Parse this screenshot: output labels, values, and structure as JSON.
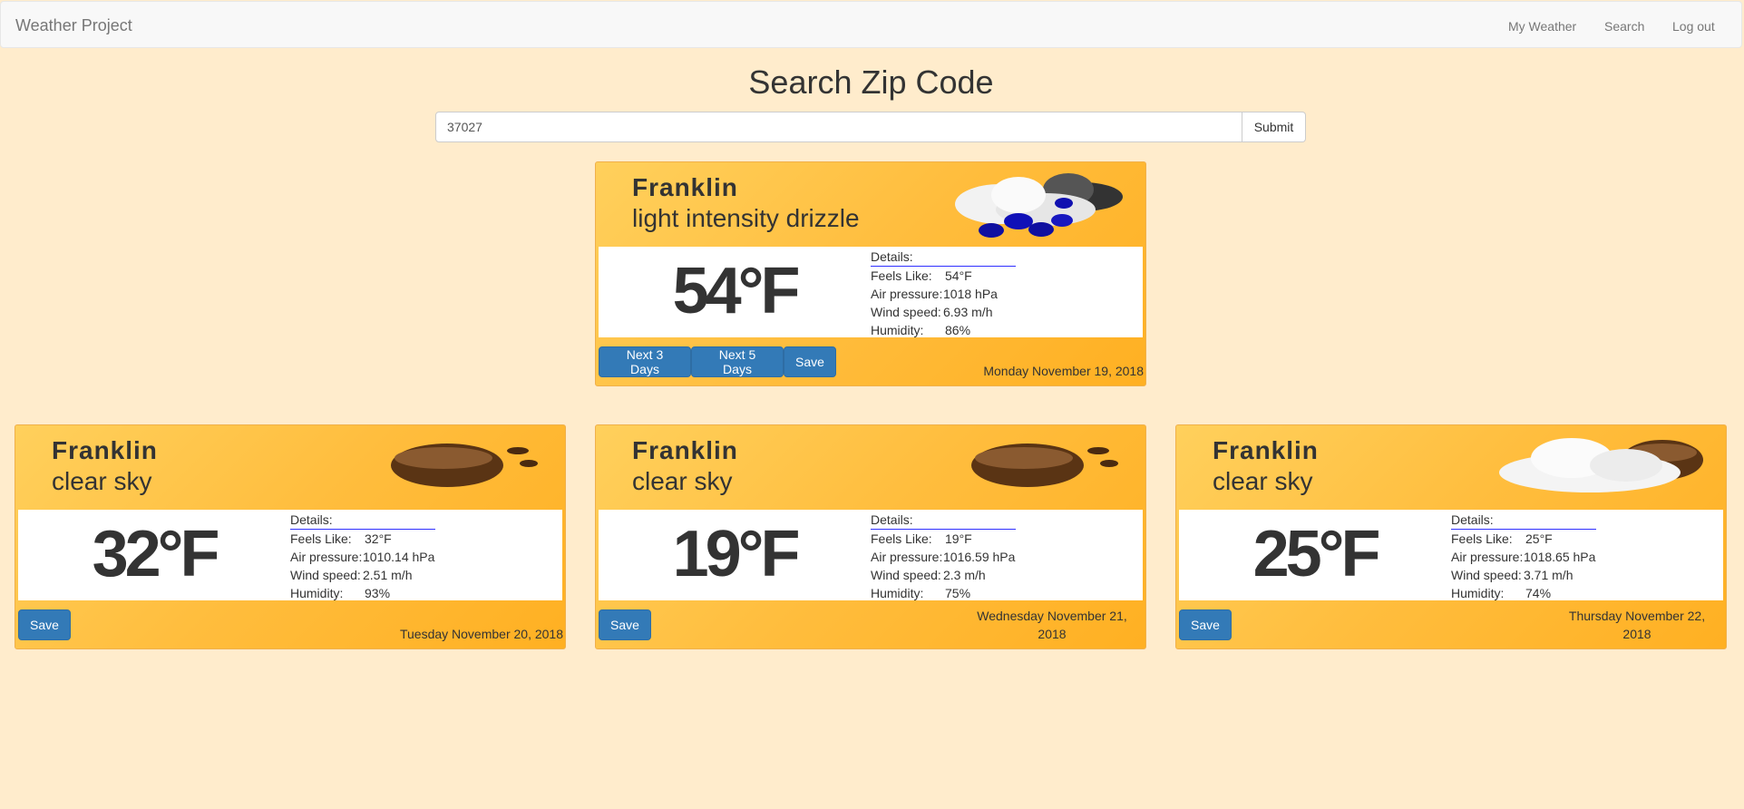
{
  "nav": {
    "brand": "Weather Project",
    "links": [
      "My Weather",
      "Search",
      "Log out"
    ]
  },
  "search": {
    "title": "Search Zip Code",
    "value": "37027",
    "submit_label": "Submit"
  },
  "details_label": "Details:",
  "labels": {
    "feels": "Feels Like:",
    "pressure": "Air pressure:",
    "wind": "Wind speed:",
    "humidity": "Humidity:"
  },
  "buttons": {
    "next3": "Next 3 Days",
    "next5": "Next 5 Days",
    "save": "Save"
  },
  "current": {
    "city": "Franklin",
    "description": "light intensity drizzle",
    "icon": "rain-cloud-icon",
    "temp": "54°F",
    "feels": "54°F",
    "pressure": "1018 hPa",
    "wind": "6.93 m/h",
    "humidity": "86%",
    "date": "Monday November 19, 2018"
  },
  "forecast": [
    {
      "city": "Franklin",
      "description": "clear sky",
      "icon": "clear-sky-icon",
      "temp": "32°F",
      "feels": "32°F",
      "pressure": "1010.14 hPa",
      "wind": "2.51 m/h",
      "humidity": "93%",
      "date": "Tuesday November 20, 2018"
    },
    {
      "city": "Franklin",
      "description": "clear sky",
      "icon": "clear-sky-icon",
      "temp": "19°F",
      "feels": "19°F",
      "pressure": "1016.59 hPa",
      "wind": "2.3 m/h",
      "humidity": "75%",
      "date_line1": "Wednesday November 21,",
      "date_line2": "2018"
    },
    {
      "city": "Franklin",
      "description": "clear sky",
      "icon": "cloud-icon",
      "temp": "25°F",
      "feels": "25°F",
      "pressure": "1018.65 hPa",
      "wind": "3.71 m/h",
      "humidity": "74%",
      "date_line1": "Thursday November 22,",
      "date_line2": "2018"
    }
  ],
  "colors": {
    "background": "#ffeccc",
    "card": "#ffbd3d",
    "button": "#337ab7"
  }
}
